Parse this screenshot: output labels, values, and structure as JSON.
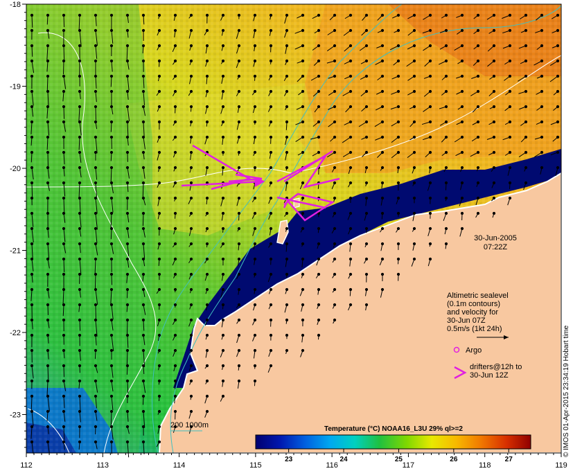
{
  "map": {
    "lon_ticks": [
      "112",
      "113",
      "114",
      "115",
      "116",
      "117",
      "118",
      "119"
    ],
    "lat_ticks": [
      "-18",
      "-19",
      "-20",
      "-21",
      "-22",
      "-23"
    ],
    "date": "30-Jun-2005",
    "time": "07:22Z",
    "credit": "© IMOS 01-Apr-2015 23:34:19 Hobart time"
  },
  "legend": {
    "sealevel_lines": [
      "Altimetric sealevel",
      "(0.1m contours)",
      "and velocity for",
      "30-Jun 07Z",
      "0.5m/s (1kt 24h)"
    ],
    "argo_label": "Argo",
    "drifters_lines": [
      "drifters@12h to",
      "30-Jun 12Z"
    ],
    "bathymetry_label": "200  1000m",
    "colors": {
      "drifter": "#e020e0",
      "argo": "#e020e0",
      "land": "#f8c8a0",
      "bathymetry": "#40c0c0",
      "contour": "#ffffff"
    }
  },
  "colorbar": {
    "title": "Temperature (°C) NOAA16_L3U 29% ql>=2",
    "ticks": [
      "23",
      "24",
      "25",
      "26",
      "27"
    ],
    "colors": [
      "#000070",
      "#0018b0",
      "#0060e0",
      "#00a8f0",
      "#00d0c0",
      "#20c040",
      "#80d800",
      "#e8e800",
      "#f8b800",
      "#f07800",
      "#d83000",
      "#900000"
    ]
  }
}
